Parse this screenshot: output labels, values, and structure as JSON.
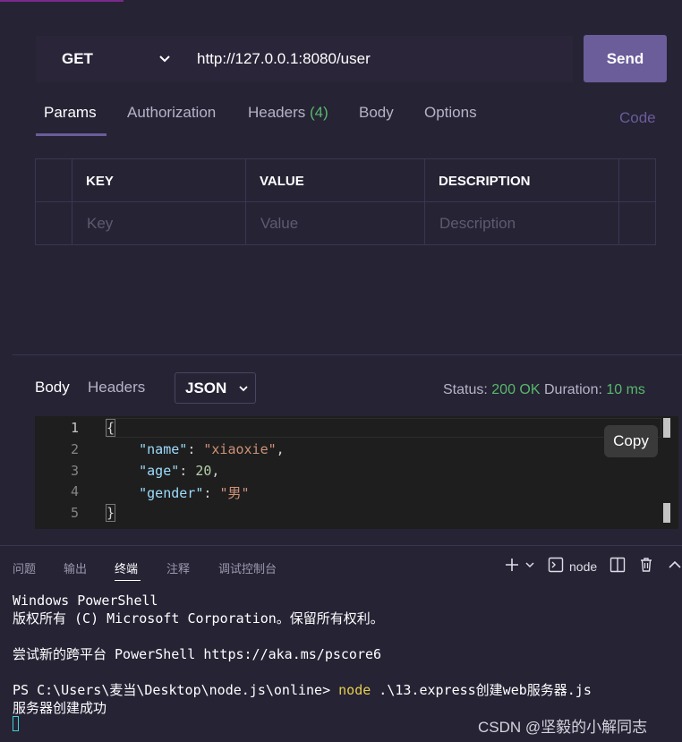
{
  "request": {
    "method": "GET",
    "url": "http://127.0.0.1:8080/user",
    "send_label": "Send"
  },
  "tabs": {
    "params": "Params",
    "authorization": "Authorization",
    "headers": "Headers",
    "headers_count": "(4)",
    "body": "Body",
    "options": "Options",
    "code": "Code"
  },
  "params_table": {
    "columns": [
      "KEY",
      "VALUE",
      "DESCRIPTION"
    ],
    "placeholders": [
      "Key",
      "Value",
      "Description"
    ]
  },
  "response": {
    "tab_body": "Body",
    "tab_headers": "Headers",
    "format": "JSON",
    "status_label": "Status:",
    "status_value": "200 OK",
    "duration_label": "Duration:",
    "duration_value": "10 ms",
    "copy_label": "Copy",
    "line_numbers": [
      "1",
      "2",
      "3",
      "4",
      "5"
    ],
    "json": {
      "open": "{",
      "close": "}",
      "k_name": "\"name\"",
      "v_name": "\"xiaoxie\"",
      "k_age": "\"age\"",
      "v_age": "20",
      "k_gender": "\"gender\"",
      "v_gender": "\"男\""
    }
  },
  "panel": {
    "tabs": [
      "问题",
      "输出",
      "终端",
      "注释",
      "调试控制台"
    ],
    "active_tab": "终端",
    "shell_name": "node"
  },
  "terminal": {
    "line1": "Windows PowerShell",
    "line2": "版权所有 (C) Microsoft Corporation。保留所有权利。",
    "line3": "尝试新的跨平台 PowerShell https://aka.ms/pscore6",
    "prompt": "PS C:\\Users\\麦当\\Desktop\\node.js\\online> ",
    "command": "node",
    "args": " .\\13.express创建web服务器.js",
    "output": "服务器创建成功"
  },
  "watermark": "CSDN @坚毅的小解同志",
  "colors": {
    "background": "#262335",
    "accent": "#6b5c9a",
    "success": "#57b86a"
  }
}
